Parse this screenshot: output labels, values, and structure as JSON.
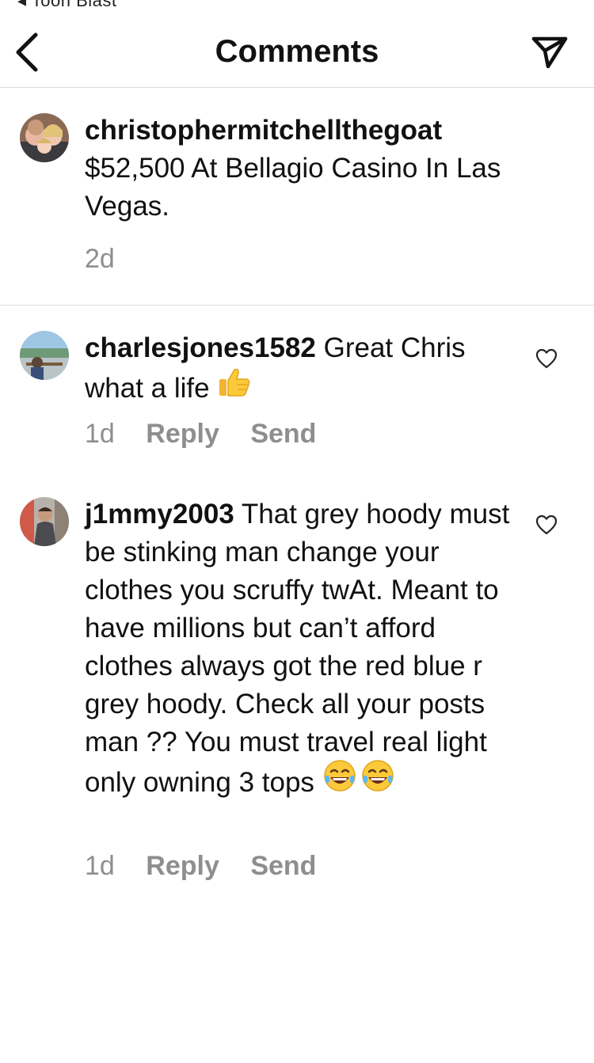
{
  "status_bar": {
    "back_label": "◂ Toon Blast"
  },
  "header": {
    "title": "Comments"
  },
  "caption": {
    "username": "christophermitchellthegoat",
    "text": "$52,500 At Bellagio Casino In Las Vegas.",
    "time": "2d"
  },
  "comments": [
    {
      "username": "charlesjones1582",
      "text": " Great Chris what a life ",
      "emoji": "thumbs-up",
      "time": "1d",
      "reply_label": "Reply",
      "send_label": "Send"
    },
    {
      "username": "j1mmy2003",
      "text": " That grey hoody must be stinking man change your clothes you scruffy twAt. Meant to have millions but can’t afford clothes always got the red blue r grey hoody. Check all your posts man ?? You must travel real light only owning 3 tops ",
      "emoji": "laughing-crying",
      "time": "1d",
      "reply_label": "Reply",
      "send_label": "Send"
    }
  ],
  "colors": {
    "text": "#111111",
    "secondary_text": "#8e8e8e",
    "divider": "#dbdbdb"
  }
}
